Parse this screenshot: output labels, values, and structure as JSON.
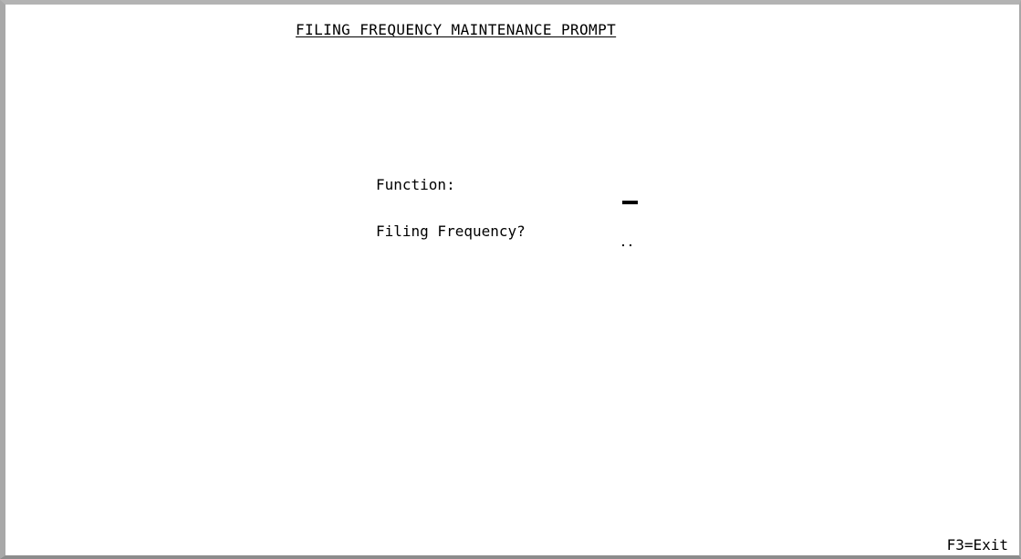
{
  "screen": {
    "title": "FILING FREQUENCY MAINTENANCE PROMPT"
  },
  "form": {
    "function_label": "Function:",
    "function_value": "",
    "frequency_label": "Filing Frequency?",
    "frequency_value": ""
  },
  "footer": {
    "f3_label": "F3=Exit"
  },
  "colors": {
    "background": "#ffffff",
    "text": "#000000",
    "frame": "#a8a8a8"
  }
}
